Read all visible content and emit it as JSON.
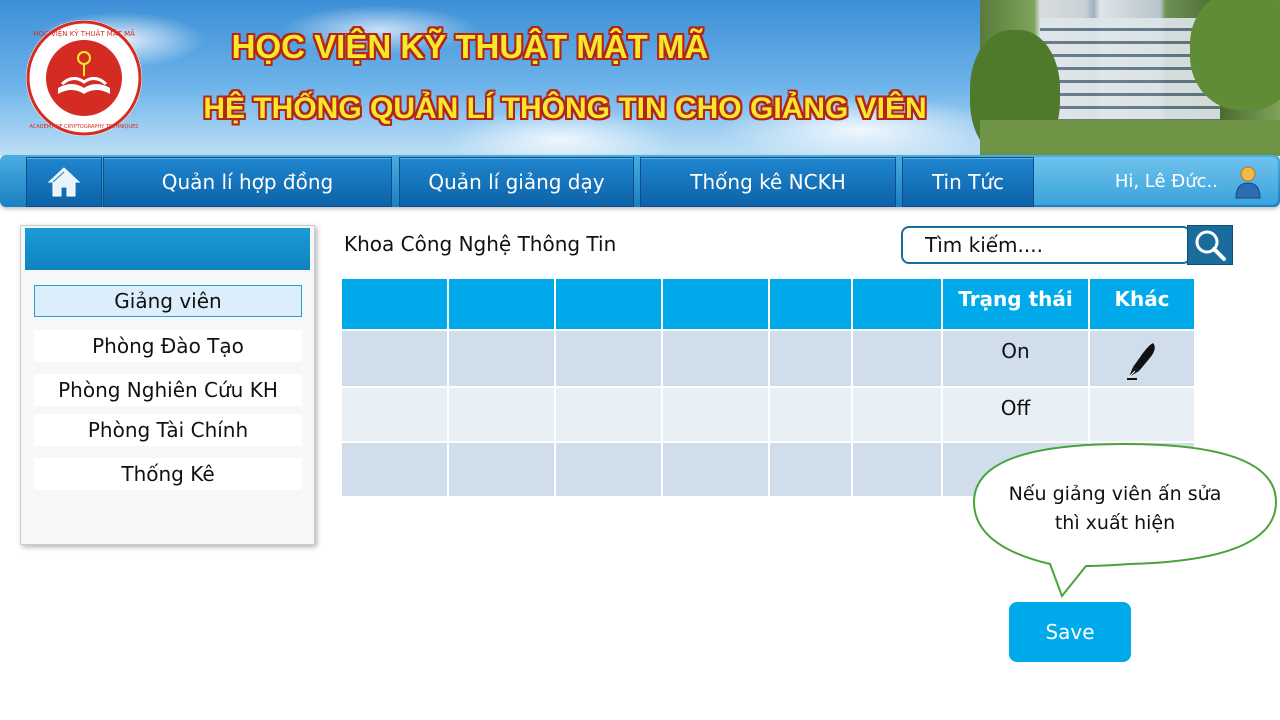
{
  "header": {
    "title": "HỌC VIỆN KỸ THUẬT MẬT MÃ",
    "subtitle": "HỆ THỐNG QUẢN LÍ THÔNG TIN CHO GIẢNG VIÊN",
    "logo_text_top": "HỌC VIỆN KỸ THUẬT MẬT MÃ",
    "logo_text_bottom": "ACADEMY OF CRYPTOGRAPHY TECHNIQUES",
    "colors": {
      "title": "#f7e82c",
      "title_outline": "#b3251c"
    }
  },
  "nav": {
    "home_icon": "home-icon",
    "items": [
      {
        "label": "Quản lí hợp đồng"
      },
      {
        "label": "Quản lí giảng dạy"
      },
      {
        "label": "Thống kê NCKH"
      },
      {
        "label": "Tin Tức"
      }
    ],
    "user_greeting": "Hi, Lê Đức..",
    "user_icon": "user-icon"
  },
  "sidebar": {
    "items": [
      {
        "label": "Giảng viên",
        "active": true
      },
      {
        "label": "Phòng Đào Tạo"
      },
      {
        "label": "Phòng Nghiên Cứu KH"
      },
      {
        "label": "Phòng Tài Chính"
      },
      {
        "label": "Thống Kê"
      }
    ]
  },
  "main": {
    "department": "Khoa Công Nghệ Thông Tin",
    "search": {
      "placeholder": "Tìm kiếm....",
      "icon": "search-icon"
    },
    "table": {
      "headers": [
        "",
        "",
        "",
        "",
        "",
        "",
        "Trạng thái",
        "Khác"
      ],
      "rows": [
        {
          "status": "On",
          "other_icon": "pen-icon"
        },
        {
          "status": "Off"
        },
        {
          "status": ""
        }
      ]
    },
    "callout": "Nếu giảng viên ấn sửa thì xuất hiện",
    "save_label": "Save",
    "colors": {
      "accent": "#00aaea",
      "row_dark": "#cfdeea",
      "row_light": "#e8f0f6"
    }
  }
}
